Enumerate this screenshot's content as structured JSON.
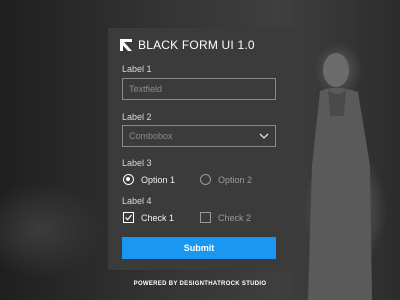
{
  "form": {
    "title": "BLACK FORM UI 1.0",
    "label1": "Label 1",
    "textfield_placeholder": "Textfield",
    "label2": "Label 2",
    "combobox_value": "Combobox",
    "label3": "Label 3",
    "option1": "Option 1",
    "option2": "Option 2",
    "label4": "Label 4",
    "check1": "Check 1",
    "check2": "Check 2",
    "submit_label": "Submit"
  },
  "footer": "POWERED BY DESIGNTHATROCK STUDIO",
  "colors": {
    "card": "#3b3b3b",
    "accent": "#1a97f0"
  },
  "state": {
    "option1_selected": true,
    "check1_checked": true
  }
}
